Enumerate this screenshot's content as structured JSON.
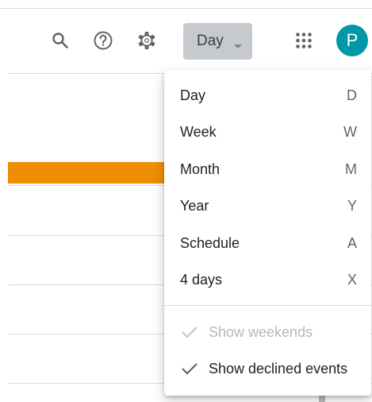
{
  "header": {
    "icons": {
      "search": "search-icon",
      "help": "help-icon",
      "settings": "gear-icon",
      "apps": "apps-grid-icon"
    },
    "view_selector": {
      "label": "Day"
    },
    "avatar": {
      "initial": "P",
      "color": "#0097a7"
    }
  },
  "calendar": {
    "event_color": "#ef8e00"
  },
  "view_menu": {
    "items": [
      {
        "label": "Day",
        "shortcut": "D"
      },
      {
        "label": "Week",
        "shortcut": "W"
      },
      {
        "label": "Month",
        "shortcut": "M"
      },
      {
        "label": "Year",
        "shortcut": "Y"
      },
      {
        "label": "Schedule",
        "shortcut": "A"
      },
      {
        "label": "4 days",
        "shortcut": "X"
      }
    ],
    "options": [
      {
        "label": "Show weekends",
        "checked": true,
        "enabled": false
      },
      {
        "label": "Show declined events",
        "checked": true,
        "enabled": true
      }
    ]
  }
}
